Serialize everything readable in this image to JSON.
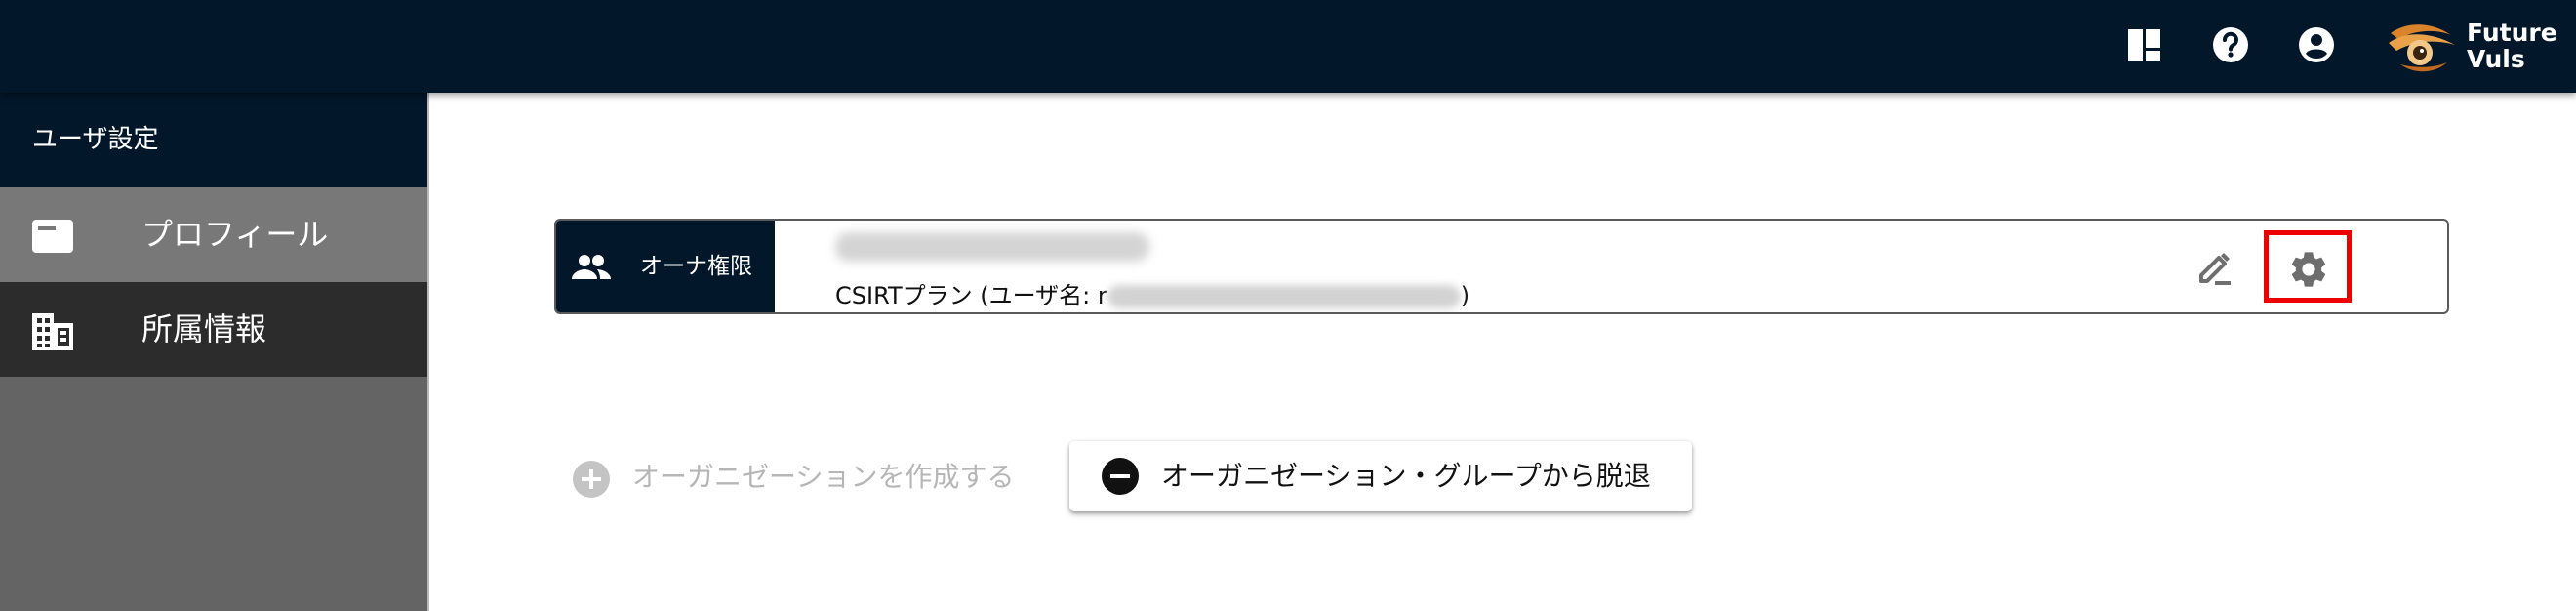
{
  "header": {
    "icons": [
      "panel-icon",
      "help-icon",
      "account-icon"
    ],
    "logo_text": "Future\nVuls"
  },
  "sidebar": {
    "title": "ユーザ設定",
    "items": [
      {
        "label": "プロフィール",
        "icon": "profile-card-icon",
        "active": false
      },
      {
        "label": "所属情報",
        "icon": "building-icon",
        "active": true
      }
    ]
  },
  "main": {
    "organization_card": {
      "role_label": "オーナ権限",
      "role_icon": "people-icon",
      "plan_prefix": "CSIRTプラン (ユーザ名: r",
      "plan_suffix": ")",
      "edit_icon": "edit-icon",
      "settings_icon": "gear-icon"
    },
    "create_org_label": "オーガニゼーションを作成する",
    "leave_label": "オーガニゼーション・グループから脱退"
  },
  "colors": {
    "header_bg": "#03172a",
    "sidebar_bg": "#646464",
    "sidebar_active_bg": "#2c2c2c",
    "highlight": "#ee0000"
  }
}
